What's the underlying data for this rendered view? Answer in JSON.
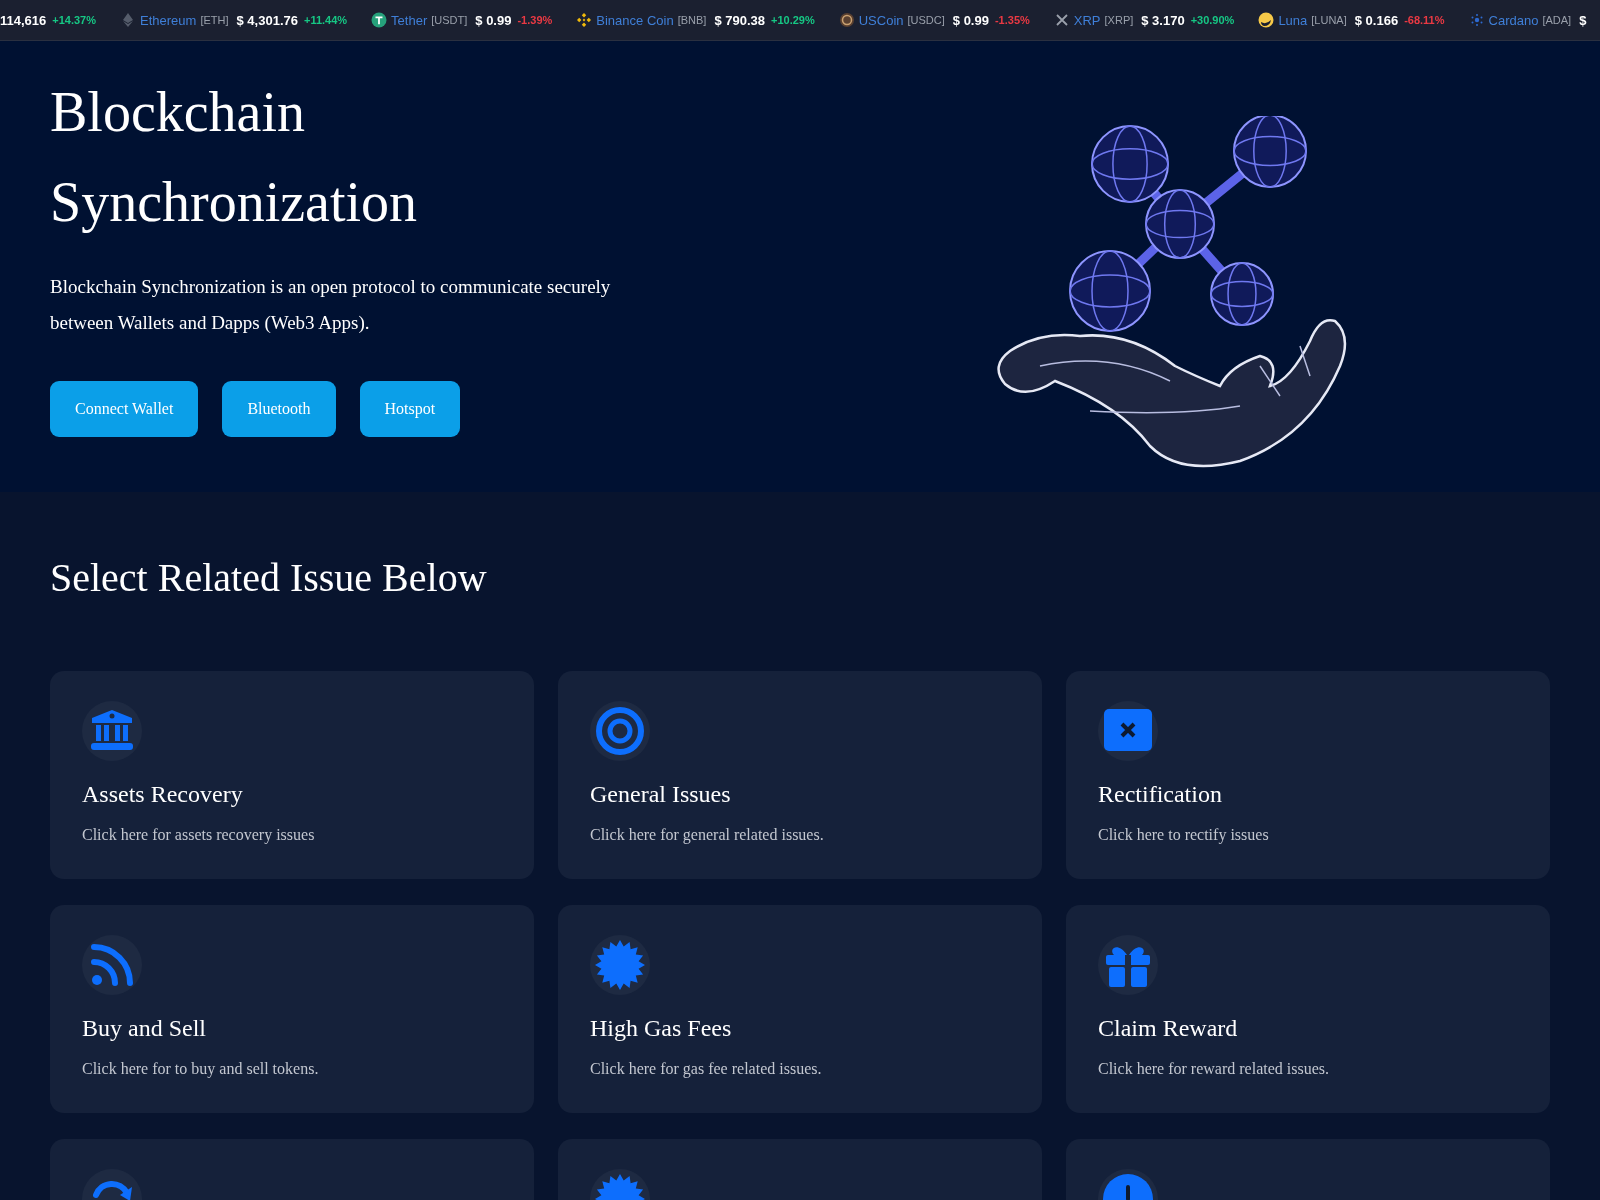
{
  "ticker": [
    {
      "price": "114,616",
      "change": "+14.37%",
      "color": "#16c784"
    },
    {
      "name": "Ethereum",
      "symbol": "[ETH]",
      "price": "$ 4,301.76",
      "change": "+11.44%",
      "color": "#16c784"
    },
    {
      "name": "Tether",
      "symbol": "[USDT]",
      "price": "$ 0.99",
      "change": "-1.39%",
      "color": "#ea3943"
    },
    {
      "name": "Binance Coin",
      "symbol": "[BNB]",
      "price": "$ 790.38",
      "change": "+10.29%",
      "color": "#16c784"
    },
    {
      "name": "USCoin",
      "symbol": "[USDC]",
      "price": "$ 0.99",
      "change": "-1.35%",
      "color": "#ea3943"
    },
    {
      "name": "XRP",
      "symbol": "[XRP]",
      "price": "$ 3.170",
      "change": "+30.90%",
      "color": "#16c784"
    },
    {
      "name": "Luna",
      "symbol": "[LUNA]",
      "price": "$ 0.166",
      "change": "-68.11%",
      "color": "#ea3943"
    },
    {
      "name": "Cardano",
      "symbol": "[ADA]",
      "price": "$"
    }
  ],
  "hero": {
    "title_lines": [
      "Blockchain",
      "Synchronization"
    ],
    "description": "Blockchain Synchronization is an open protocol to communicate securely between Wallets and Dapps (Web3 Apps).",
    "buttons": [
      "Connect Wallet",
      "Bluetooth",
      "Hotspot"
    ],
    "image": {
      "kind": "picture"
    }
  },
  "issues": {
    "heading": "Select Related Issue Below",
    "cards": [
      {
        "kind": "full",
        "title": "Assets Recovery",
        "description": "Click here for assets recovery issues"
      },
      {
        "kind": "full",
        "title": "General Issues",
        "description": "Click here for general related issues."
      },
      {
        "kind": "full",
        "title": "Rectification",
        "description": "Click here to rectify issues"
      },
      {
        "kind": "full",
        "title": "Buy and Sell",
        "description": "Click here for to buy and sell tokens."
      },
      {
        "kind": "full",
        "title": "High Gas Fees",
        "description": "Click here for gas fee related issues."
      },
      {
        "kind": "full",
        "title": "Claim Reward",
        "description": "Click here for reward related issues."
      },
      {
        "kind": "cut"
      },
      {
        "kind": "cut"
      },
      {
        "kind": "cut"
      }
    ]
  }
}
